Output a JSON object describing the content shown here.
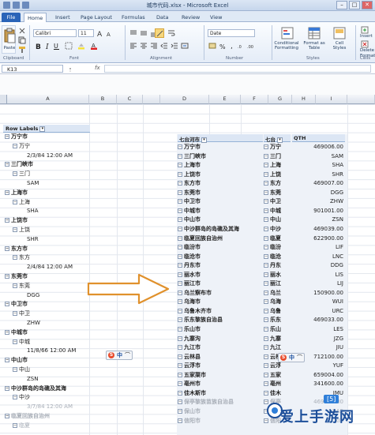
{
  "window": {
    "title": "城市代码.xlsx - Microsoft Excel",
    "controls": [
      "–",
      "□",
      "✕"
    ]
  },
  "tabs": [
    "File",
    "Home",
    "Insert",
    "Page Layout",
    "Formulas",
    "Data",
    "Review",
    "View"
  ],
  "ribbon": {
    "font_name": "Calibri",
    "font_size": "11",
    "number_format": "Date",
    "groups": [
      "Clipboard",
      "Font",
      "Alignment",
      "Number",
      "Styles",
      "Cells"
    ],
    "styles_buttons": [
      "Conditional Formatting",
      "Format as Table",
      "Cell Styles"
    ],
    "cells_buttons": [
      "Insert",
      "Delete",
      "Format"
    ],
    "paste_label": "Paste"
  },
  "formula_bar": {
    "name_box": "K13",
    "fx": "fx",
    "content": ""
  },
  "columns": [
    "A",
    "B",
    "C",
    "D",
    "E",
    "F",
    "G",
    "H",
    "I"
  ],
  "left_pivot": {
    "header": "Row Labels",
    "rows": [
      {
        "level": 1,
        "text": "万宁市"
      },
      {
        "level": 2,
        "text": "万宁"
      },
      {
        "level": 3,
        "text": "2/3/84 12:00 AM"
      },
      {
        "level": 1,
        "text": "三门峡市"
      },
      {
        "level": 2,
        "text": "三门"
      },
      {
        "level": 3,
        "text": "SAM"
      },
      {
        "level": 1,
        "text": "上海市"
      },
      {
        "level": 2,
        "text": "上海"
      },
      {
        "level": 3,
        "text": "SHA"
      },
      {
        "level": 1,
        "text": "上饶市"
      },
      {
        "level": 2,
        "text": "上饶"
      },
      {
        "level": 3,
        "text": "SHR"
      },
      {
        "level": 1,
        "text": "东方市"
      },
      {
        "level": 2,
        "text": "东方"
      },
      {
        "level": 3,
        "text": "2/4/84 12:00 AM"
      },
      {
        "level": 1,
        "text": "东莞市"
      },
      {
        "level": 2,
        "text": "东莞"
      },
      {
        "level": 3,
        "text": "DGG"
      },
      {
        "level": 1,
        "text": "中卫市"
      },
      {
        "level": 2,
        "text": "中卫"
      },
      {
        "level": 3,
        "text": "ZHW"
      },
      {
        "level": 1,
        "text": "中城市"
      },
      {
        "level": 2,
        "text": "中城"
      },
      {
        "level": 3,
        "text": "11/8/66 12:00 AM"
      },
      {
        "level": 1,
        "text": "中山市"
      },
      {
        "level": 2,
        "text": "中山"
      },
      {
        "level": 3,
        "text": "ZSN"
      },
      {
        "level": 1,
        "text": "中沙群岛的岛礁及其海"
      },
      {
        "level": 2,
        "text": "中沙"
      },
      {
        "level": 3,
        "text": "3/7/84 12:00 AM"
      },
      {
        "level": 1,
        "text": "临夏回族自治州"
      },
      {
        "level": 2,
        "text": "临夏"
      }
    ]
  },
  "right_pivot": {
    "headers": [
      "七台河市",
      "七台",
      "QTH"
    ],
    "rows": [
      [
        "万宁市",
        "万宁",
        "469006.00"
      ],
      [
        "三门峡市",
        "三门",
        "SAM"
      ],
      [
        "上海市",
        "上海",
        "SHA"
      ],
      [
        "上饶市",
        "上饶",
        "SHR"
      ],
      [
        "东方市",
        "东方",
        "469007.00"
      ],
      [
        "东莞市",
        "东莞",
        "DGG"
      ],
      [
        "中卫市",
        "中卫",
        "ZHW"
      ],
      [
        "中城市",
        "中城",
        "901001.00"
      ],
      [
        "中山市",
        "中山",
        "ZSN"
      ],
      [
        "中沙群岛的岛礁及其海",
        "中沙",
        "469039.00"
      ],
      [
        "临夏回族自治州",
        "临夏",
        "622900.00"
      ],
      [
        "临汾市",
        "临汾",
        "LIF"
      ],
      [
        "临沧市",
        "临沧",
        "LNC"
      ],
      [
        "丹东市",
        "丹东",
        "DDG"
      ],
      [
        "丽水市",
        "丽水",
        "LIS"
      ],
      [
        "丽江市",
        "丽江",
        "LIJ"
      ],
      [
        "乌兰察布市",
        "乌兰",
        "150900.00"
      ],
      [
        "乌海市",
        "乌海",
        "WUI"
      ],
      [
        "乌鲁木齐市",
        "乌鲁",
        "URC"
      ],
      [
        "乐东黎族自治县",
        "乐东",
        "469033.00"
      ],
      [
        "乐山市",
        "乐山",
        "LES"
      ],
      [
        "九寨沟",
        "九寨",
        "JZG"
      ],
      [
        "九江市",
        "九江",
        "JIU"
      ],
      [
        "云林县",
        "云林",
        "712100.00"
      ],
      [
        "云浮市",
        "云浮",
        "YUF"
      ],
      [
        "五家渠市",
        "五家",
        "659004.00"
      ],
      [
        "亳州市",
        "亳州",
        "341600.00"
      ],
      [
        "佳木斯市",
        "佳木",
        "JMU"
      ],
      [
        "保亭黎族苗族自治县",
        "保亭",
        "469035.00"
      ],
      [
        "保山市",
        "保山",
        "BAS"
      ],
      [
        "信阳市",
        "信阳",
        "XIY"
      ]
    ]
  },
  "ime_toolbar": {
    "logo": "S",
    "lang": "中",
    "extra": "⌒"
  },
  "watermark": {
    "text": "爱上手游网",
    "badge": "[5]"
  }
}
